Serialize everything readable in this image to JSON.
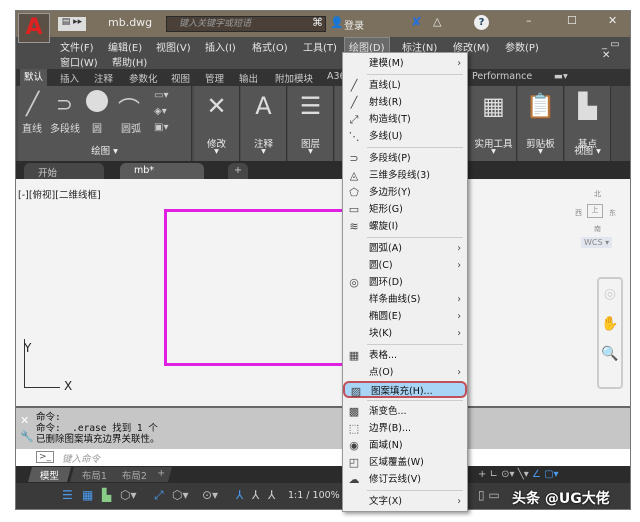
{
  "title_bar": {
    "filename": "mb.dwg",
    "search_placeholder": "键入关键字或短语",
    "login": "登录",
    "min": "–",
    "max": "☐",
    "close": "✕"
  },
  "menubar": {
    "items": [
      "文件(F)",
      "编辑(E)",
      "视图(V)",
      "插入(I)",
      "格式(O)",
      "工具(T)",
      "绘图(D)",
      "标注(N)",
      "修改(M)",
      "参数(P)",
      "窗口(W)",
      "帮助(H)"
    ]
  },
  "ribbon": {
    "tabs": [
      "默认",
      "插入",
      "注释",
      "参数化",
      "视图",
      "管理",
      "输出",
      "附加模块",
      "A36",
      "Performance"
    ],
    "draw_tools": [
      "直线",
      "多段线",
      "圆",
      "圆弧"
    ],
    "draw_panel": "绘图 ▾",
    "panels": [
      "修改",
      "注释",
      "图层",
      "实用工具",
      "剪贴板",
      "基点"
    ],
    "view_panel": "视图 ▾"
  },
  "doc_tabs": [
    "开始",
    "mb*",
    "+"
  ],
  "viewport_label": "[-][俯视][二维线框]",
  "viewcube": {
    "north": "北",
    "south": "南",
    "east": "东",
    "west": "西",
    "top": "上",
    "wcs": "WCS ▾"
  },
  "axes": {
    "x": "X",
    "y": "Y"
  },
  "command": {
    "lines": [
      "命令:",
      "命令: _.erase 找到 1 个",
      "已删除图案填充边界关联性。"
    ],
    "placeholder": "键入命令"
  },
  "layout_tabs": [
    "模型",
    "布局1",
    "布局2",
    "+"
  ],
  "status": {
    "scale": "1:1 / 100%"
  },
  "watermark": "头条 @UG大佬",
  "draw_menu": {
    "items": [
      {
        "label": "建模(M)",
        "icon": "",
        "sub": true
      },
      {
        "sep": true
      },
      {
        "label": "直线(L)",
        "icon": "╱"
      },
      {
        "label": "射线(R)",
        "icon": "╱"
      },
      {
        "label": "构造线(T)",
        "icon": "⤢"
      },
      {
        "label": "多线(U)",
        "icon": "⋱"
      },
      {
        "sep": true
      },
      {
        "label": "多段线(P)",
        "icon": "⊃"
      },
      {
        "label": "三维多段线(3)",
        "icon": "◬"
      },
      {
        "label": "多边形(Y)",
        "icon": "⬠"
      },
      {
        "label": "矩形(G)",
        "icon": "▭"
      },
      {
        "label": "螺旋(I)",
        "icon": "≋"
      },
      {
        "sep": true
      },
      {
        "label": "圆弧(A)",
        "icon": "",
        "sub": true
      },
      {
        "label": "圆(C)",
        "icon": "",
        "sub": true
      },
      {
        "label": "圆环(D)",
        "icon": "◎"
      },
      {
        "label": "样条曲线(S)",
        "icon": "",
        "sub": true
      },
      {
        "label": "椭圆(E)",
        "icon": "",
        "sub": true
      },
      {
        "label": "块(K)",
        "icon": "",
        "sub": true
      },
      {
        "sep": true
      },
      {
        "label": "表格...",
        "icon": "▦"
      },
      {
        "label": "点(O)",
        "icon": "",
        "sub": true
      },
      {
        "label": "图案填充(H)...",
        "icon": "▨",
        "highlight": true
      },
      {
        "sep": true
      },
      {
        "label": "渐变色...",
        "icon": "▩"
      },
      {
        "label": "边界(B)...",
        "icon": "⬚"
      },
      {
        "label": "面域(N)",
        "icon": "◉"
      },
      {
        "label": "区域覆盖(W)",
        "icon": "◰"
      },
      {
        "label": "修订云线(V)",
        "icon": "☁"
      },
      {
        "sep": true
      },
      {
        "label": "文字(X)",
        "icon": "",
        "sub": true
      }
    ]
  }
}
